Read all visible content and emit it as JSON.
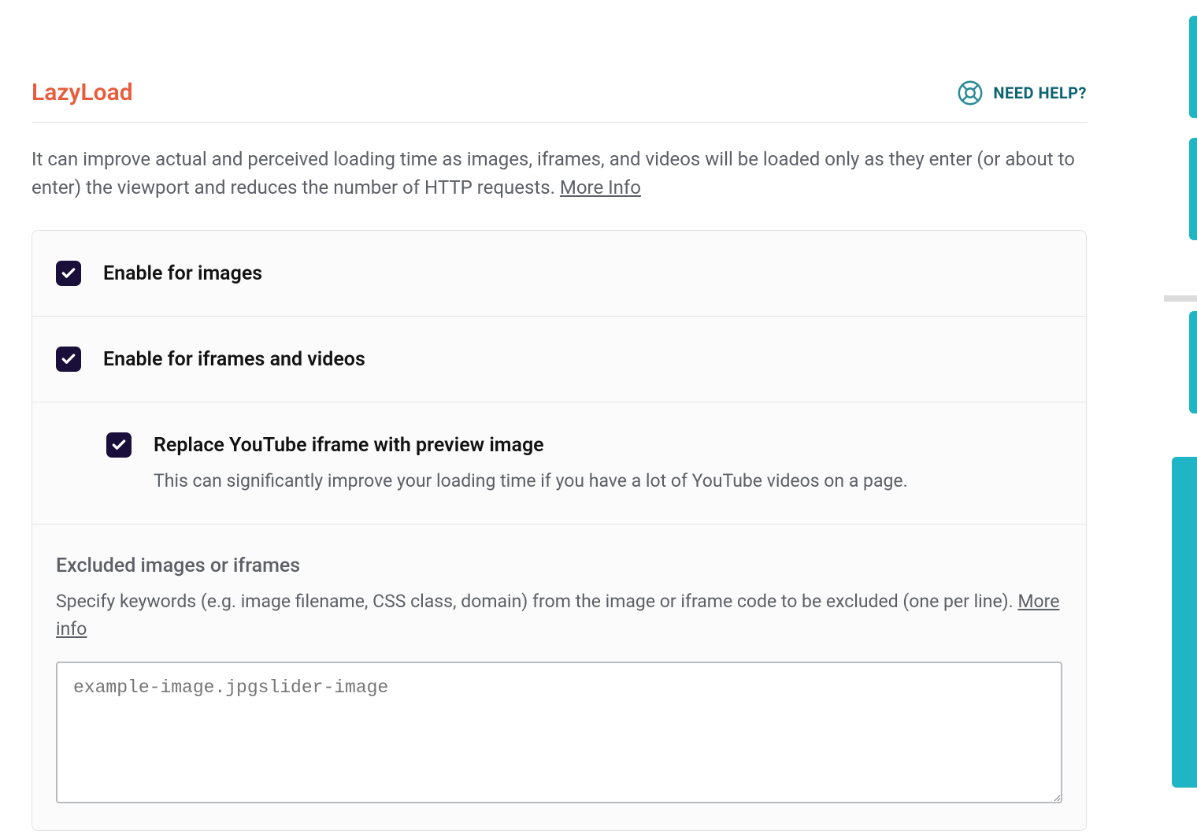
{
  "section": {
    "title": "LazyLoad",
    "help_label": "NEED HELP?",
    "description": "It can improve actual and perceived loading time as images, iframes, and videos will be loaded only as they enter (or about to enter) the viewport and reduces the number of HTTP requests. ",
    "more_info": "More Info"
  },
  "options": {
    "enable_images": {
      "label": "Enable for images",
      "checked": true
    },
    "enable_iframes": {
      "label": "Enable for iframes and videos",
      "checked": true
    },
    "replace_youtube": {
      "label": "Replace YouTube iframe with preview image",
      "description": "This can significantly improve your loading time if you have a lot of YouTube videos on a page.",
      "checked": true
    }
  },
  "excluded": {
    "title": "Excluded images or iframes",
    "description": "Specify keywords (e.g. image filename, CSS class, domain) from the image or iframe code to be excluded (one per line). ",
    "more_info": "More info",
    "placeholder": "example-image.jpgslider-image"
  }
}
